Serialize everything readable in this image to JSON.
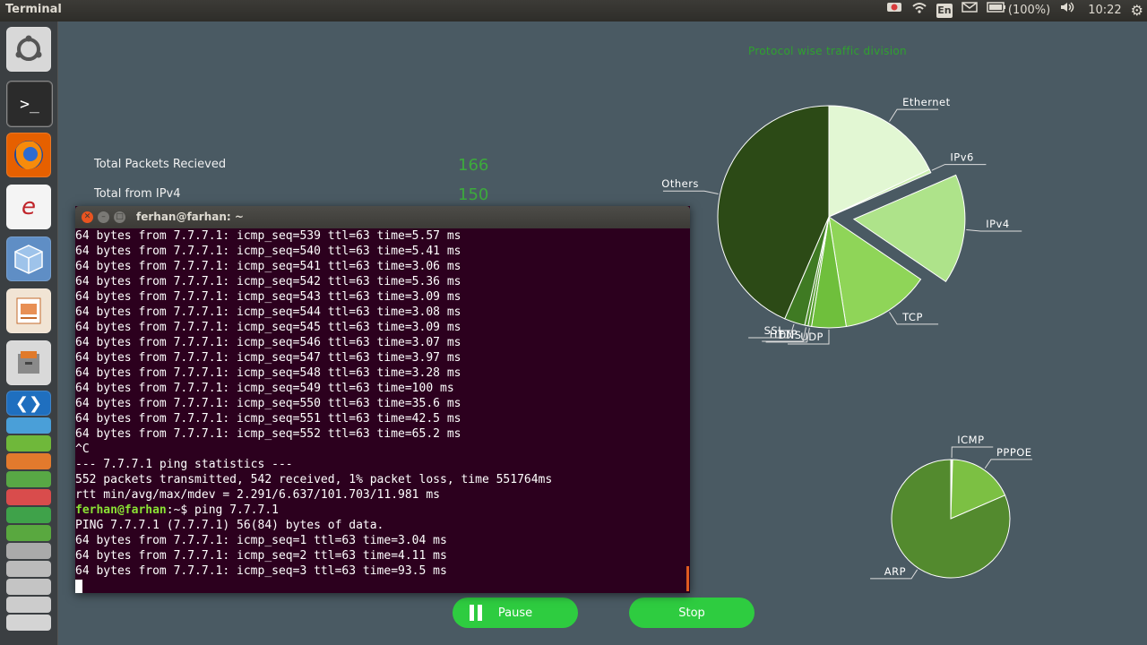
{
  "panel": {
    "app_title": "Terminal",
    "keyboard": "En",
    "battery": "(100%)",
    "time": "10:22"
  },
  "launcher": {
    "items": [
      "ubuntu-dash",
      "terminal",
      "firefox",
      "libreoffice",
      "virtualbox",
      "impress",
      "file-manager",
      "code"
    ]
  },
  "stats": {
    "packets_label": "Total Packets Recieved",
    "packets_value": "166",
    "ipv4_label": "Total from IPv4",
    "ipv4_value": "150"
  },
  "terminal": {
    "title": "ferhan@farhan: ~",
    "lines": [
      "64 bytes from 7.7.7.1: icmp_seq=539 ttl=63 time=5.57 ms",
      "64 bytes from 7.7.7.1: icmp_seq=540 ttl=63 time=5.41 ms",
      "64 bytes from 7.7.7.1: icmp_seq=541 ttl=63 time=3.06 ms",
      "64 bytes from 7.7.7.1: icmp_seq=542 ttl=63 time=5.36 ms",
      "64 bytes from 7.7.7.1: icmp_seq=543 ttl=63 time=3.09 ms",
      "64 bytes from 7.7.7.1: icmp_seq=544 ttl=63 time=3.08 ms",
      "64 bytes from 7.7.7.1: icmp_seq=545 ttl=63 time=3.09 ms",
      "64 bytes from 7.7.7.1: icmp_seq=546 ttl=63 time=3.07 ms",
      "64 bytes from 7.7.7.1: icmp_seq=547 ttl=63 time=3.97 ms",
      "64 bytes from 7.7.7.1: icmp_seq=548 ttl=63 time=3.28 ms",
      "64 bytes from 7.7.7.1: icmp_seq=549 ttl=63 time=100 ms",
      "64 bytes from 7.7.7.1: icmp_seq=550 ttl=63 time=35.6 ms",
      "64 bytes from 7.7.7.1: icmp_seq=551 ttl=63 time=42.5 ms",
      "64 bytes from 7.7.7.1: icmp_seq=552 ttl=63 time=65.2 ms",
      "^C",
      "--- 7.7.7.1 ping statistics ---",
      "552 packets transmitted, 542 received, 1% packet loss, time 551764ms",
      "rtt min/avg/max/mdev = 2.291/6.637/101.703/11.981 ms"
    ],
    "prompt_user": "ferhan@farhan",
    "prompt_rest": ":~$ ping 7.7.7.1",
    "after_lines": [
      "PING 7.7.7.1 (7.7.7.1) 56(84) bytes of data.",
      "64 bytes from 7.7.7.1: icmp_seq=1 ttl=63 time=3.04 ms",
      "64 bytes from 7.7.7.1: icmp_seq=2 ttl=63 time=4.11 ms",
      "64 bytes from 7.7.7.1: icmp_seq=3 ttl=63 time=93.5 ms"
    ]
  },
  "buttons": {
    "pause": "Pause",
    "stop": "Stop"
  },
  "chart_data": [
    {
      "type": "pie",
      "title": "Protocol wise traffic division",
      "exploded": [
        "IPv4"
      ],
      "slices": [
        {
          "label": "Ethernet",
          "percent": 18,
          "color": "#e2f7d3"
        },
        {
          "label": "IPv6",
          "percent": 0.5,
          "color": "#cbeeb2"
        },
        {
          "label": "IPv4",
          "percent": 16,
          "color": "#aee38a"
        },
        {
          "label": "TCP",
          "percent": 13,
          "color": "#8fd558"
        },
        {
          "label": "UDP",
          "percent": 5,
          "color": "#6fbf3c"
        },
        {
          "label": "DNS",
          "percent": 0.5,
          "color": "#5aa530"
        },
        {
          "label": "HTTP",
          "percent": 0.5,
          "color": "#4d8f2a"
        },
        {
          "label": "SSL",
          "percent": 3,
          "color": "#3f7a23"
        },
        {
          "label": "Others",
          "percent": 43.5,
          "color": "#2c4a16"
        }
      ]
    },
    {
      "type": "pie",
      "slices": [
        {
          "label": "ICMP",
          "percent": 0.5,
          "color": "#ffffff"
        },
        {
          "label": "PPPOE",
          "percent": 18,
          "color": "#7cc043"
        },
        {
          "label": "ARP",
          "percent": 81.5,
          "color": "#538a2e"
        }
      ]
    }
  ]
}
